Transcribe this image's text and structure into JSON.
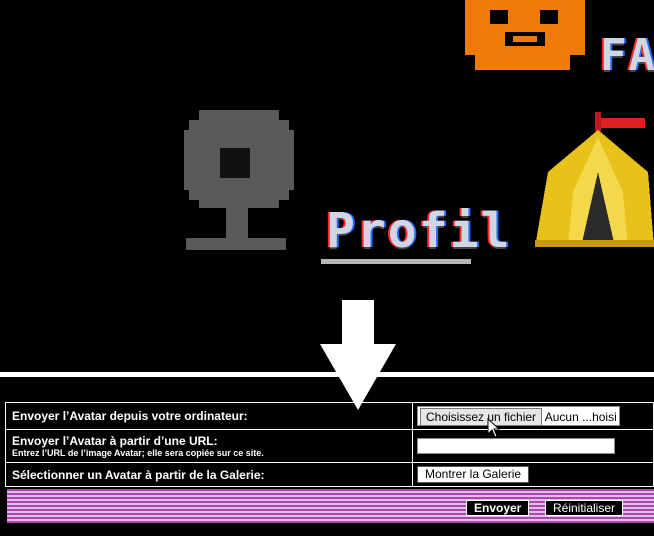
{
  "header": {
    "nav_profile_label": "Profil",
    "nav_partial_label": "FA"
  },
  "form": {
    "upload_label": "Envoyer l’Avatar depuis votre ordinateur:",
    "file_button_label": "Choisissez un fichier",
    "file_status": "Aucun ...hoisi",
    "url_label": "Envoyer l’Avatar à partir d’une URL:",
    "url_hint": "Entrez l’URL de l’image Avatar; elle sera copiée sur ce site.",
    "url_value": "",
    "gallery_label": "Sélectionner un Avatar à partir de la Galerie:",
    "gallery_button_label": "Montrer la Galerie",
    "submit_label": "Envoyer",
    "reset_label": "Réinitialiser"
  },
  "colors": {
    "background": "#000000",
    "stripe_dark": "#a24ea8",
    "stripe_light": "#e9b8ec",
    "freddy_orange": "#f07a06",
    "tent_yellow": "#e8c21a"
  },
  "icons": [
    "freddy-face-icon",
    "webcam-icon",
    "circus-tent-icon",
    "down-arrow-icon",
    "mouse-cursor-icon"
  ]
}
